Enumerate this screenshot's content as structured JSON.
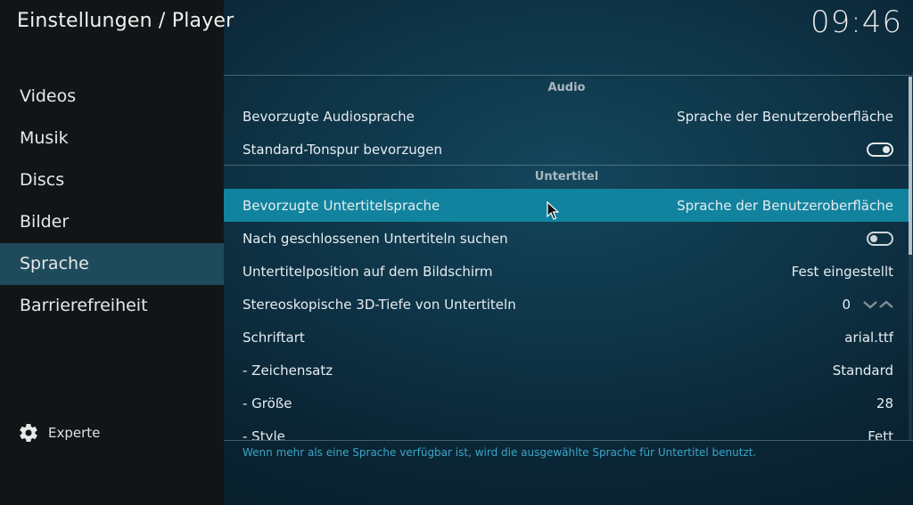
{
  "header": {
    "title": "Einstellungen / Player",
    "clock": "09:46"
  },
  "sidebar": {
    "items": [
      {
        "label": "Videos",
        "active": false
      },
      {
        "label": "Musik",
        "active": false
      },
      {
        "label": "Discs",
        "active": false
      },
      {
        "label": "Bilder",
        "active": false
      },
      {
        "label": "Sprache",
        "active": true
      },
      {
        "label": "Barrierefreiheit",
        "active": false
      }
    ],
    "level_label": "Experte",
    "level_icon": "gear-icon"
  },
  "sections": {
    "audio": {
      "header": "Audio",
      "rows": [
        {
          "label": "Bevorzugte Audiosprache",
          "value": "Sprache der Benutzeroberfläche"
        },
        {
          "label": "Standard-Tonspur bevorzugen",
          "toggle": "on"
        }
      ]
    },
    "subtitles": {
      "header": "Untertitel",
      "rows": [
        {
          "label": "Bevorzugte Untertitelsprache",
          "value": "Sprache der Benutzeroberfläche",
          "focused": true
        },
        {
          "label": "Nach geschlossenen Untertiteln suchen",
          "toggle": "off"
        },
        {
          "label": "Untertitelposition auf dem Bildschirm",
          "value": "Fest eingestellt"
        },
        {
          "label": "Stereoskopische 3D-Tiefe von Untertiteln",
          "value": "0"
        },
        {
          "label": "Schriftart",
          "value": "arial.ttf"
        },
        {
          "label": "- Zeichensatz",
          "value": "Standard"
        },
        {
          "label": "- Größe",
          "value": "28"
        },
        {
          "label": "- Style",
          "value": "Fett"
        }
      ]
    }
  },
  "help_text": "Wenn mehr als eine Sprache verfügbar ist, wird die ausgewählte Sprache für Untertitel benutzt.",
  "colors": {
    "focus": "#12839f",
    "sidebar_active": "#1e4a5c",
    "help_text": "#3aa6c8"
  }
}
